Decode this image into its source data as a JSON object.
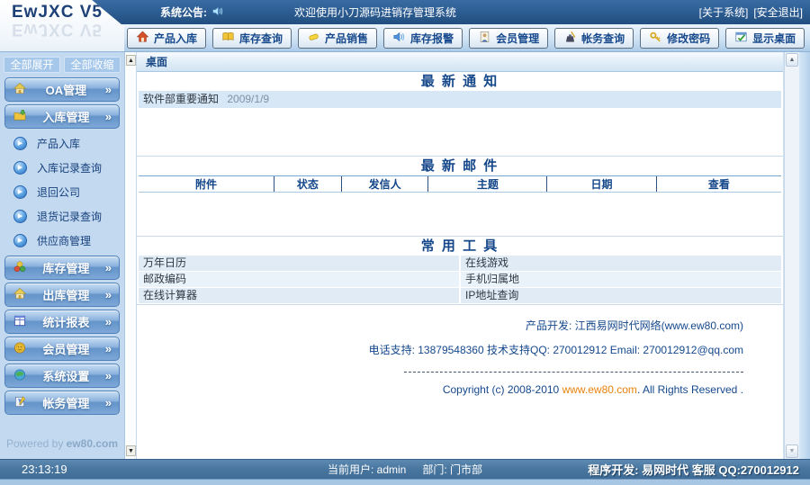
{
  "logo": {
    "brand": "EwJXC V5"
  },
  "icons": {
    "chevron_right": "»",
    "play": "▶",
    "scroll_up": "▲",
    "scroll_down": "▼"
  },
  "topbar": {
    "announce_label": "系统公告:",
    "welcome": "欢迎使用小刀源码进销存管理系统",
    "about": "[关于系统]",
    "logout": "[安全退出]"
  },
  "toolbar": {
    "buttons": [
      {
        "label": "产品入库",
        "icon": "house-in-icon"
      },
      {
        "label": "库存查询",
        "icon": "book-icon"
      },
      {
        "label": "产品销售",
        "icon": "tag-icon"
      },
      {
        "label": "库存报警",
        "icon": "speaker-icon"
      },
      {
        "label": "会员管理",
        "icon": "member-icon"
      },
      {
        "label": "帐务查询",
        "icon": "ledger-icon"
      },
      {
        "label": "修改密码",
        "icon": "key-icon"
      },
      {
        "label": "显示桌面",
        "icon": "desktop-icon"
      }
    ]
  },
  "sidebar": {
    "expand_all": "全部展开",
    "collapse_all": "全部收缩",
    "categories": [
      {
        "label": "OA管理",
        "icon": "oa-house-icon"
      },
      {
        "label": "入库管理",
        "icon": "inbound-folder-icon"
      },
      {
        "label": "库存管理",
        "icon": "stock-pie-icon"
      },
      {
        "label": "出库管理",
        "icon": "outbound-house-icon"
      },
      {
        "label": "统计报表",
        "icon": "report-chart-icon"
      },
      {
        "label": "会员管理",
        "icon": "member-coin-icon"
      },
      {
        "label": "系统设置",
        "icon": "globe-icon"
      },
      {
        "label": "帐务管理",
        "icon": "account-pen-icon"
      }
    ],
    "inbound_items": [
      "产品入库",
      "入库记录查询",
      "退回公司",
      "退货记录查询",
      "供应商管理"
    ],
    "powered_prefix": "Powered by",
    "powered_brand": "ew80.com"
  },
  "content": {
    "tab": "桌面",
    "notices": {
      "title": "最 新 通 知",
      "items": [
        {
          "text": "软件部重要通知",
          "date": "2009/1/9"
        }
      ]
    },
    "mail": {
      "title": "最 新 邮 件",
      "columns": [
        "附件",
        "状态",
        "发信人",
        "主题",
        "日期",
        "查看"
      ]
    },
    "tools": {
      "title": "常 用 工 具",
      "items": [
        "万年日历",
        "在线游戏",
        "邮政编码",
        "手机归属地",
        "在线计算器",
        "IP地址查询"
      ]
    },
    "footer": {
      "dev": "产品开发: 江西易网时代网络(www.ew80.com)",
      "support": "电话支持: 13879548360 技术支持QQ: 270012912 Email: 270012912@qq.com",
      "copyright_prefix": "Copyright (c) 2008-2010 ",
      "copyright_link": "www.ew80.com",
      "copyright_suffix": ". All Rights Reserved ."
    }
  },
  "statusbar": {
    "time": "23:13:19",
    "user": "当前用户: admin",
    "dept": "部门: 门市部",
    "dev_info": "程序开发: 易网时代 客服 QQ:270012912"
  },
  "colors": {
    "topbar_blue": "#2b5b90",
    "sidebar_blue": "#c3d9f0",
    "accent_text": "#14478a",
    "orange_link": "#e8820c"
  }
}
